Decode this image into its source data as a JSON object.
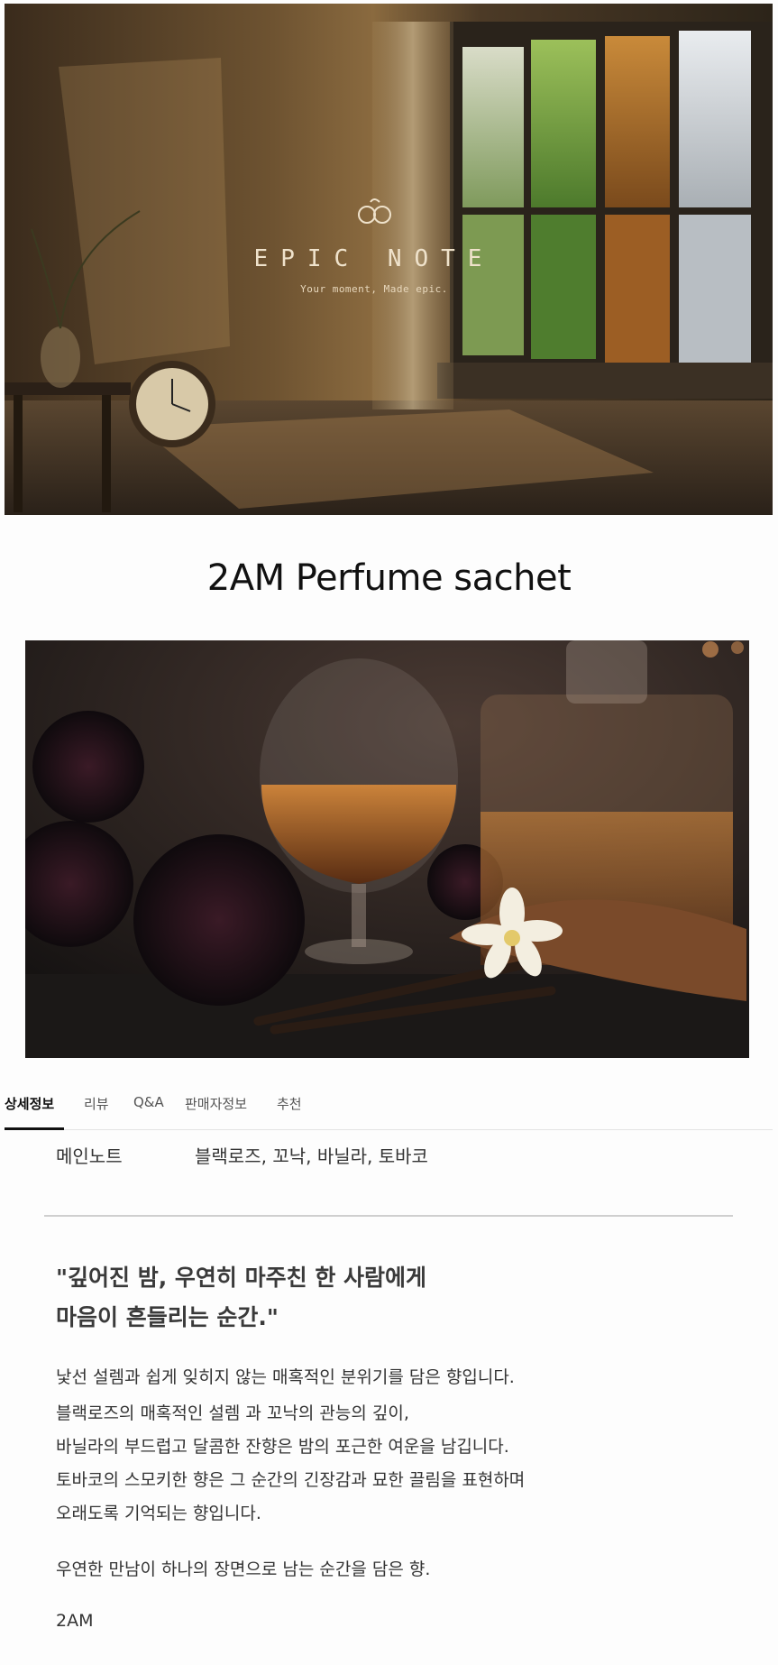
{
  "hero": {
    "brand_name": "EPIC NOTE",
    "tagline": "Your moment, Made epic."
  },
  "product": {
    "title": "2AM Perfume sachet"
  },
  "tabs": [
    {
      "label": "상세정보",
      "active": true
    },
    {
      "label": "리뷰",
      "active": false
    },
    {
      "label": "Q&A",
      "active": false
    },
    {
      "label": "판매자정보",
      "active": false
    },
    {
      "label": "추천",
      "active": false
    }
  ],
  "detail": {
    "main_note_label": "메인노트",
    "main_note_value": "블랙로즈, 꼬낙, 바닐라, 토바코",
    "quote_line1": "\"깊어진 밤, 우연히 마주친 한 사람에게",
    "quote_line2": "마음이 흔들리는 순간.\"",
    "paragraphs": [
      "낯선 설렘과 쉽게 잊히지 않는 매혹적인 분위기를 담은 향입니다.",
      "블랙로즈의 매혹적인 설렘 과 꼬낙의 관능의 깊이,",
      "바닐라의 부드럽고 달콤한 잔향은 밤의 포근한 여운을 남깁니다.",
      "토바코의 스모키한 향은 그 순간의 긴장감과 묘한 끌림을 표현하며",
      "오래도록 기억되는 향입니다."
    ],
    "closing": "우연한 만남이 하나의 장면으로 남는 순간을 담은 향.",
    "signature": "2AM"
  }
}
